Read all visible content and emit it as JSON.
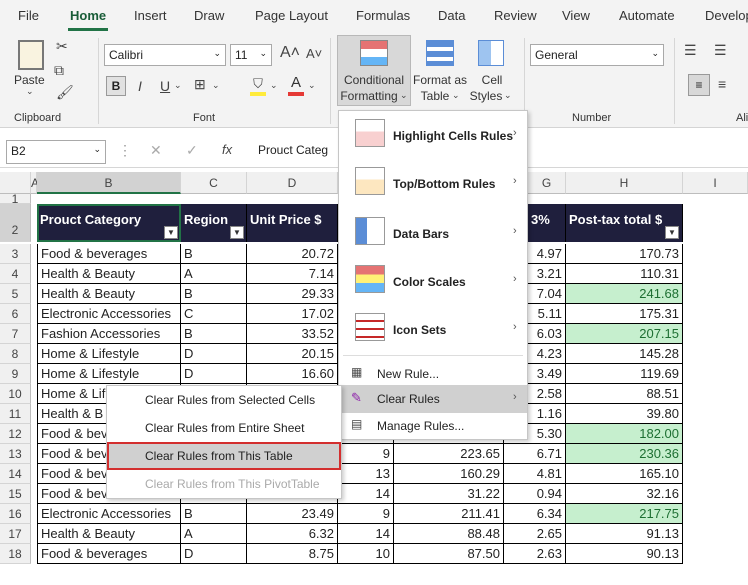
{
  "menu_tabs": [
    "File",
    "Home",
    "Insert",
    "Draw",
    "Page Layout",
    "Formulas",
    "Data",
    "Review",
    "View",
    "Automate",
    "Develop"
  ],
  "ribbon": {
    "paste_label": "Paste",
    "clipboard_group": "Clipboard",
    "font_name": "Calibri",
    "font_size": "11",
    "font_group": "Font",
    "conditional_formatting_line1": "Conditional",
    "conditional_formatting_line2": "Formatting",
    "format_as_table_line1": "Format as",
    "format_as_table_line2": "Table",
    "cell_styles_line1": "Cell",
    "cell_styles_line2": "Styles",
    "number_format": "General",
    "number_group": "Number",
    "alignment_group_partial": "Ali"
  },
  "formula_bar": {
    "name_box": "B2",
    "fx": "fx",
    "content": "Prouct Categ"
  },
  "columns": [
    "A",
    "B",
    "C",
    "D",
    "G",
    "H",
    "I"
  ],
  "rows": [
    "1",
    "2",
    "3",
    "4",
    "5",
    "6",
    "7",
    "8",
    "9",
    "10",
    "11",
    "12",
    "13",
    "14",
    "15",
    "16",
    "17",
    "18"
  ],
  "table_headers": {
    "category": "Prouct Category",
    "region": "Region",
    "unit_price": "Unit Price $",
    "tax": "3%",
    "post_tax": "Post-tax total $"
  },
  "data_rows": [
    {
      "cat": "Food & beverages",
      "reg": "B",
      "price": "20.72",
      "qty": "",
      "sub": "",
      "tax": "4.97",
      "total": "170.73",
      "hl": false
    },
    {
      "cat": "Health & Beauty",
      "reg": "A",
      "price": "7.14",
      "qty": "",
      "sub": "",
      "tax": "3.21",
      "total": "110.31",
      "hl": false
    },
    {
      "cat": "Health & Beauty",
      "reg": "B",
      "price": "29.33",
      "qty": "",
      "sub": "",
      "tax": "7.04",
      "total": "241.68",
      "hl": true
    },
    {
      "cat": "Electronic Accessories",
      "reg": "C",
      "price": "17.02",
      "qty": "",
      "sub": "",
      "tax": "5.11",
      "total": "175.31",
      "hl": false
    },
    {
      "cat": "Fashion Accessories",
      "reg": "B",
      "price": "33.52",
      "qty": "",
      "sub": "",
      "tax": "6.03",
      "total": "207.15",
      "hl": true
    },
    {
      "cat": "Home & Lifestyle",
      "reg": "D",
      "price": "20.15",
      "qty": "",
      "sub": "",
      "tax": "4.23",
      "total": "145.28",
      "hl": false
    },
    {
      "cat": "Home & Lifestyle",
      "reg": "D",
      "price": "16.60",
      "qty": "",
      "sub": "",
      "tax": "3.49",
      "total": "119.69",
      "hl": false
    },
    {
      "cat": "Home & Lif",
      "reg": "",
      "price": "",
      "qty": "",
      "sub": "",
      "tax": "2.58",
      "total": "88.51",
      "hl": false
    },
    {
      "cat": "Health & B",
      "reg": "",
      "price": "",
      "qty": "",
      "sub": "",
      "tax": "1.16",
      "total": "39.80",
      "hl": false
    },
    {
      "cat": "Food & bev",
      "reg": "",
      "price": "",
      "qty": "",
      "sub": "",
      "tax": "5.30",
      "total": "182.00",
      "hl": true
    },
    {
      "cat": "Food & bev",
      "reg": "",
      "price": "",
      "qty": "9",
      "sub": "223.65",
      "tax": "6.71",
      "total": "230.36",
      "hl": true
    },
    {
      "cat": "Food & bev",
      "reg": "",
      "price": "",
      "qty": "13",
      "sub": "160.29",
      "tax": "4.81",
      "total": "165.10",
      "hl": false
    },
    {
      "cat": "Food & bev",
      "reg": "",
      "price": "",
      "qty": "14",
      "sub": "31.22",
      "tax": "0.94",
      "total": "32.16",
      "hl": false
    },
    {
      "cat": "Electronic Accessories",
      "reg": "B",
      "price": "23.49",
      "qty": "9",
      "sub": "211.41",
      "tax": "6.34",
      "total": "217.75",
      "hl": true
    },
    {
      "cat": "Health & Beauty",
      "reg": "A",
      "price": "6.32",
      "qty": "14",
      "sub": "88.48",
      "tax": "2.65",
      "total": "91.13",
      "hl": false
    },
    {
      "cat": "Food & beverages",
      "reg": "D",
      "price": "8.75",
      "qty": "10",
      "sub": "87.50",
      "tax": "2.63",
      "total": "90.13",
      "hl": false
    }
  ],
  "cf_menu": {
    "highlight": "Highlight Cells Rules",
    "topbottom": "Top/Bottom Rules",
    "databars": "Data Bars",
    "colorscales": "Color Scales",
    "iconsets": "Icon Sets",
    "newrule": "New Rule...",
    "clearrules": "Clear Rules",
    "managerules": "Manage Rules..."
  },
  "clear_submenu": {
    "selected": "Clear Rules from Selected Cells",
    "sheet": "Clear Rules from Entire Sheet",
    "table": "Clear Rules from This Table",
    "pivot": "Clear Rules from This PivotTable"
  },
  "colors": {
    "accent": "#217346",
    "table_header": "#1f1f3d",
    "highlight_fill": "#c6efce",
    "highlight_text": "#1d6f32",
    "selection_border": "#d32f2f"
  }
}
